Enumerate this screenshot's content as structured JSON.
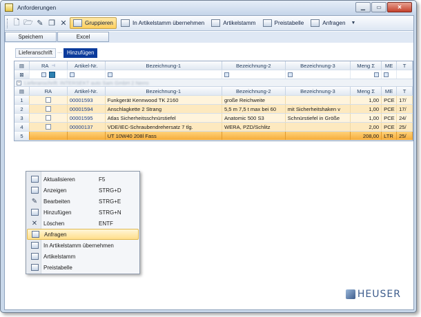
{
  "window": {
    "title": "Anforderungen"
  },
  "toolbar": {
    "group_label": "Gruppieren",
    "items": [
      {
        "label": "In Artikelstamm übernehmen"
      },
      {
        "label": "Artikelstamm"
      },
      {
        "label": "Preistabelle"
      },
      {
        "label": "Anfragen"
      }
    ]
  },
  "buttons": {
    "save": "Speichern",
    "excel": "Excel"
  },
  "breadcrumb": {
    "first": "Lieferanschrift",
    "active": "Hinzufügen"
  },
  "columns": {
    "ra": "RA",
    "art": "Artikel-Nr.",
    "bez1": "Bezeichnung-1",
    "bez2": "Bezeichnung-2",
    "bez3": "Bezeichnung-3",
    "menge": "Meng",
    "me": "ME",
    "t": "T"
  },
  "group_text": "Lieferanschrift: INTERSEKT auto Sam GmbH 2 Nerro",
  "rows": [
    {
      "n": "1",
      "art": "00001593",
      "bez1": "Funkgerät Kennwood TK 2160",
      "bez2": "große Reichweite",
      "bez3": "",
      "menge": "1,00",
      "me": "PCE",
      "t": "17/"
    },
    {
      "n": "2",
      "art": "00001594",
      "bez1": "Anschlagkette 2 Strang",
      "bez2": "5,5 m 7,5 t max bei 60",
      "bez3": "mit Sicherheitshaken v",
      "menge": "1,00",
      "me": "PCE",
      "t": "17/"
    },
    {
      "n": "3",
      "art": "00001595",
      "bez1": "Atlas Sicherheitsschnürstiefel",
      "bez2": "Anatomic 500 S3",
      "bez3": "Schnürstiefel in Größe",
      "menge": "1,00",
      "me": "PCE",
      "t": "24/"
    },
    {
      "n": "4",
      "art": "00000137",
      "bez1": "VDE/IEC-Schraubendrehersatz 7 tlg.",
      "bez2": "WERA, PZD/Schlitz",
      "bez3": "",
      "menge": "2,00",
      "me": "PCE",
      "t": "25/"
    },
    {
      "n": "5",
      "art": "",
      "bez1": "UT 10W40 208l Fass",
      "bez2": "",
      "bez3": "",
      "menge": "208,00",
      "me": "LTR",
      "t": "25/"
    }
  ],
  "context_menu": [
    {
      "label": "Aktualisieren",
      "shortcut": "F5",
      "icon": "refresh-icon"
    },
    {
      "label": "Anzeigen",
      "shortcut": "STRG+D",
      "icon": "view-icon"
    },
    {
      "label": "Bearbeiten",
      "shortcut": "STRG+E",
      "icon": "edit-icon"
    },
    {
      "label": "Hinzufügen",
      "shortcut": "STRG+N",
      "icon": "add-icon"
    },
    {
      "label": "Löschen",
      "shortcut": "ENTF",
      "icon": "delete-icon"
    },
    {
      "label": "Anfragen",
      "shortcut": "",
      "icon": "inquiry-icon"
    },
    {
      "label": "In Artikelstamm übernehmen",
      "shortcut": "",
      "icon": "transfer-icon"
    },
    {
      "label": "Artikelstamm",
      "shortcut": "",
      "icon": "article-master-icon"
    },
    {
      "label": "Preistabelle",
      "shortcut": "",
      "icon": "price-table-icon"
    }
  ],
  "logo": {
    "text": "HEUSER"
  },
  "colors": {
    "selected_row": "#f6ac3a",
    "accent": "#0b3b9c",
    "row_highlight": "#fff4dc"
  }
}
